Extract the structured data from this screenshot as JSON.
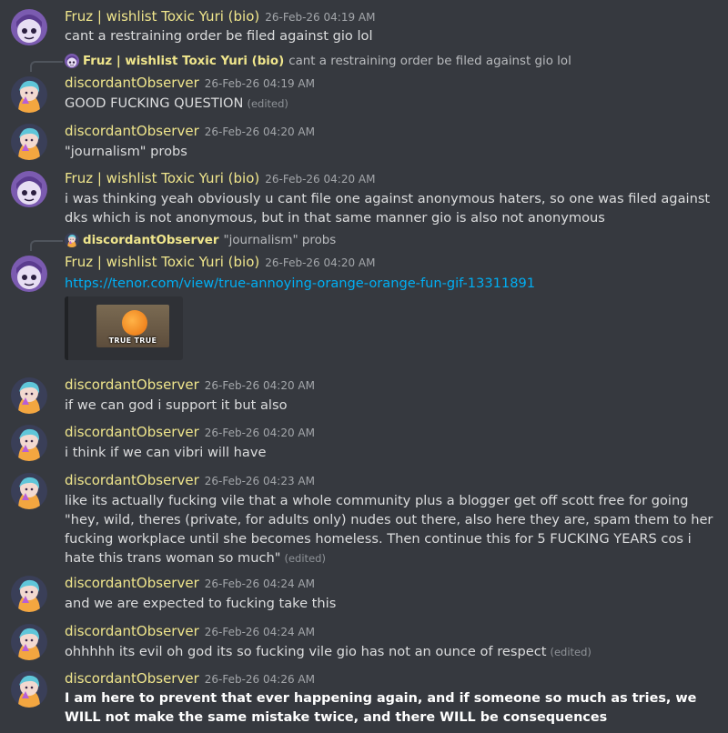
{
  "users": {
    "fruz": "Fruz | wishlist Toxic Yuri (bio)",
    "obs": "discordantObserver"
  },
  "edited_label": "(edited)",
  "messages": [
    {
      "user": "Fruz | wishlist Toxic Yuri (bio)",
      "timestamp": "26-Feb-26 04:19 AM",
      "text": "cant a restraining order be filed against gio lol"
    },
    {
      "reply_to_user": "Fruz | wishlist Toxic Yuri (bio)",
      "reply_preview": "cant a restraining order be filed against gio lol",
      "user": "discordantObserver",
      "timestamp": "26-Feb-26 04:19 AM",
      "text": "GOOD FUCKING QUESTION",
      "edited": "(edited)"
    },
    {
      "user": "discordantObserver",
      "timestamp": "26-Feb-26 04:20 AM",
      "text": "\"journalism\" probs"
    },
    {
      "user": "Fruz | wishlist Toxic Yuri (bio)",
      "timestamp": "26-Feb-26 04:20 AM",
      "text": "i was thinking yeah obviously u cant file one against anonymous haters, so one was filed against dks which is not anonymous, but in that same manner gio is also not anonymous"
    },
    {
      "reply_to_user": "discordantObserver",
      "reply_preview": "\"journalism\" probs",
      "user": "Fruz | wishlist Toxic Yuri (bio)",
      "timestamp": "26-Feb-26 04:20 AM",
      "link": "https://tenor.com/view/true-annoying-orange-orange-fun-gif-13311891",
      "gif_caption": "TRUE TRUE"
    },
    {
      "user": "discordantObserver",
      "timestamp": "26-Feb-26 04:20 AM",
      "text": "if we can god i support it but also"
    },
    {
      "user": "discordantObserver",
      "timestamp": "26-Feb-26 04:20 AM",
      "text": "i think if we can vibri will have"
    },
    {
      "user": "discordantObserver",
      "timestamp": "26-Feb-26 04:23 AM",
      "text": "like its actually fucking vile that a whole community plus a blogger get off scott free for going \"hey, wild, theres (private, for adults only) nudes out there, also here they are, spam them to her fucking workplace until she becomes homeless. Then continue this for 5  FUCKING YEARS cos i hate this trans woman so much\"",
      "edited": "(edited)"
    },
    {
      "user": "discordantObserver",
      "timestamp": "26-Feb-26 04:24 AM",
      "text": "and we are expected to fucking take this"
    },
    {
      "user": "discordantObserver",
      "timestamp": "26-Feb-26 04:24 AM",
      "text": "ohhhhh its evil oh god its so fucking vile gio has  not an ounce of respect",
      "edited": "(edited)"
    },
    {
      "user": "discordantObserver",
      "timestamp": "26-Feb-26 04:26 AM",
      "text": " I am here to prevent that ever happening again, and if someone so much as tries, we WILL not make the same mistake twice, and there WILL be consequences"
    }
  ]
}
